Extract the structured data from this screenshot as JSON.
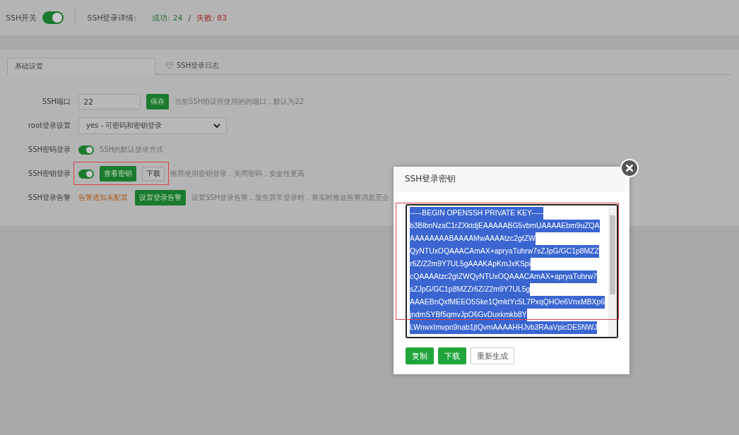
{
  "header": {
    "switch_label": "SSH开关",
    "switch_on": true,
    "details_label": "SSH登录详情:",
    "success": "成功: 24",
    "separator": "/",
    "failure": "失败: 83"
  },
  "tabs": [
    {
      "label": "基础设置",
      "selected": true,
      "kind": "text"
    },
    {
      "label": "SSH登录日志",
      "selected": false,
      "kind": "icon_text"
    }
  ],
  "rows": [
    {
      "kind": "input",
      "label": "SSH端口",
      "value": "22",
      "button": "保存",
      "hint": "当前SSH协议所使用的的端口，默认为22"
    },
    {
      "kind": "select",
      "label": "root登录设置",
      "value": "yes - 可密码和密钥登录"
    },
    {
      "kind": "toggle",
      "label": "SSH密码登录",
      "on": true,
      "hint": "SSH的默认登录方式"
    },
    {
      "kind": "toggle_buttons",
      "label": "SSH密钥登录",
      "on": true,
      "buttons": [
        {
          "label": "查看密钥",
          "primary": true
        },
        {
          "label": "下载",
          "primary": false
        }
      ],
      "hint": "推荐使用密钥登录，关闭密码，安全性更高"
    },
    {
      "kind": "alert",
      "label": "SSH登录告警",
      "status": "告警通知未配置",
      "button": "设置登录告警",
      "hint": "设置SSH登录告警，发生异常登录时，将实时推送告警消息至企"
    }
  ],
  "modal": {
    "title": "SSH登录密钥",
    "key_lines": [
      "-----BEGIN OPENSSH PRIVATE KEY-----",
      "b3BlbnNzaC1rZXktdjEAAAAABG5vbmUAAAAEbm9uZQA",
      "AAAAAAAABAAAAMwAAAAtzc2gtZW",
      "QyNTUxOQAAACAmAX+apryaTuhrw7sZJpG/GC1p8MZZ",
      "r6Z/Z2m9Y7UL5gAAAKApKmJxKSpi",
      "cQAAAAtzc2gtZWQyNTUxOQAAACAmAX+apryaTuhrw7",
      "sZJpG/GC1p8MZZr6Z/Z2m9Y7UL5g",
      "AAAEBnQxfMEEO5Ske1QmktYc5L7PxqQHOe6VnxMBXp6",
      "jndmSYBf5qmvJpO6GvDuxkmkb8Y",
      "LWnwxImvpn9nab1jtQvmAAAAHHJvb3RAaVpicDE5NWJ"
    ],
    "buttons": [
      {
        "label": "复制",
        "primary": true
      },
      {
        "label": "下载",
        "primary": true
      },
      {
        "label": "重新生成",
        "primary": false
      }
    ]
  }
}
